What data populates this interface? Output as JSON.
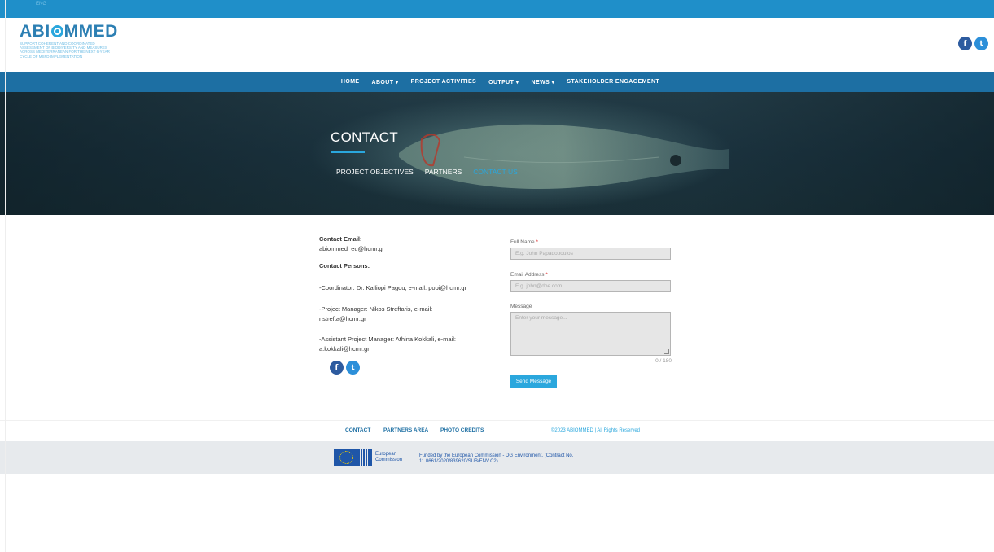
{
  "topbar": {
    "tiny_text": "ENG"
  },
  "header": {
    "logo_prefix": "ABI",
    "logo_suffix": "MMED",
    "logo_tagline": "Support coherent and coordinated assessment of biodiversity and measures across Mediterranean for the next 6-year cycle of MSFD implementation",
    "social": [
      {
        "name": "facebook-icon",
        "glyph": "f"
      },
      {
        "name": "twitter-icon",
        "glyph": "t"
      }
    ]
  },
  "nav": {
    "items": [
      {
        "label": "HOME"
      },
      {
        "label": "ABOUT ▾"
      },
      {
        "label": "PROJECT ACTIVITIES"
      },
      {
        "label": "OUTPUT ▾"
      },
      {
        "label": "NEWS ▾"
      },
      {
        "label": "STAKEHOLDER ENGAGEMENT"
      }
    ]
  },
  "hero": {
    "title": "CONTACT",
    "sub_nav": [
      {
        "label": "PROJECT OBJECTIVES",
        "active": false
      },
      {
        "label": "PARTNERS",
        "active": false
      },
      {
        "label": "CONTACT US",
        "active": true
      }
    ]
  },
  "contact": {
    "email_label": "Contact Email:",
    "email_value": "abiommed_eu@hcmr.gr",
    "persons_label": "Contact Persons:",
    "coordinator": "-Coordinator: Dr. Kalliopi Pagou, e-mail: popi@hcmr.gr",
    "manager_1": "-Project Manager: Nikos Streftaris, e-mail:",
    "manager_2": "nstrefta@hcmr.gr",
    "assistant_1": "-Assistant Project Manager: Athina Kokkali, e-mail:",
    "assistant_2": "a.kokkali@hcmr.gr"
  },
  "form": {
    "name_label": "Full Name",
    "name_placeholder": "E.g. John Papadopoulos",
    "email_label": "Email Address",
    "email_placeholder": "E.g. john@doe.com",
    "message_label": "Message",
    "message_placeholder": "Enter your message...",
    "counter": "0 / 180",
    "required_mark": "*",
    "submit_label": "Send Message"
  },
  "footer": {
    "links": [
      {
        "label": "CONTACT"
      },
      {
        "label": "PARTNERS AREA"
      },
      {
        "label": "PHOTO CREDITS"
      }
    ],
    "copyright": "©2023 ABIOMMED | All Rights Reserved",
    "eu_name_1": "European",
    "eu_name_2": "Commission",
    "funding_1": "Funded by the European Commission - DG Environment. (Contract No.",
    "funding_2": "11.0661/2020/839620/SUB/ENV.C2)"
  },
  "colors": {
    "top_bar": "#1f8fc9",
    "nav": "#1d6fa3",
    "accent": "#2aa7dd",
    "footer_bg": "#e7eaed"
  }
}
